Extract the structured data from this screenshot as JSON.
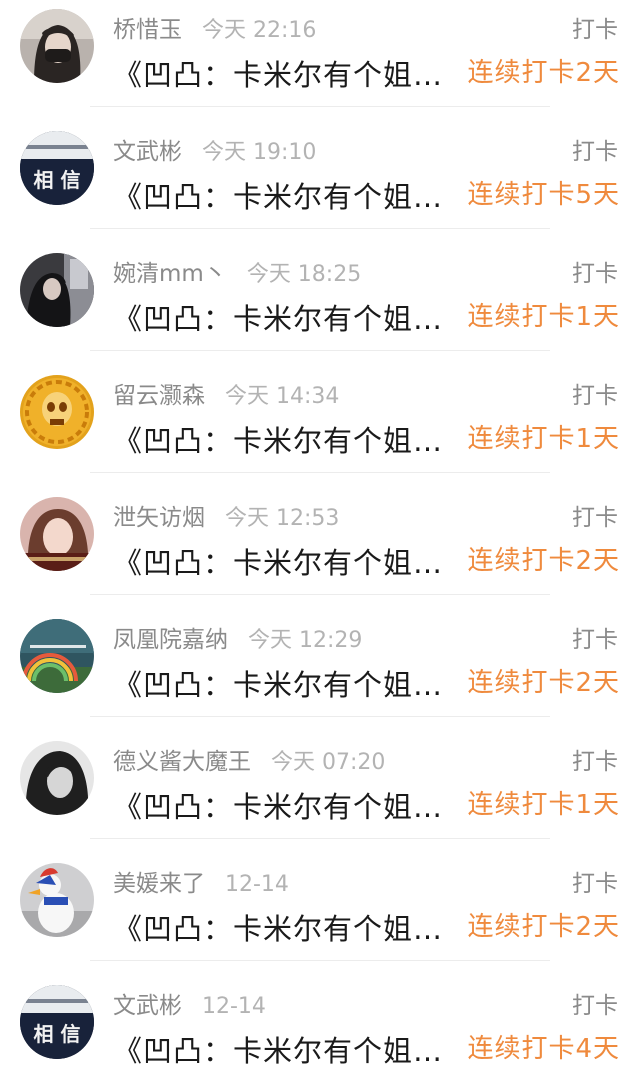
{
  "feed": {
    "items": [
      {
        "name": "桥惜玉",
        "time": "今天 22:16",
        "action": "打卡",
        "title": "《凹凸：卡米尔有个姐…",
        "streak": "连续打卡2天",
        "avatar": "avatar-masked-girl"
      },
      {
        "name": "文武彬",
        "time": "今天 19:10",
        "action": "打卡",
        "title": "《凹凸：卡米尔有个姐…",
        "streak": "连续打卡5天",
        "avatar": "avatar-text-xiangxin"
      },
      {
        "name": "婉清mm丶",
        "time": "今天 18:25",
        "action": "打卡",
        "title": "《凹凸：卡米尔有个姐…",
        "streak": "连续打卡1天",
        "avatar": "avatar-dark-figure"
      },
      {
        "name": "留云灏森",
        "time": "今天 14:34",
        "action": "打卡",
        "title": "《凹凸：卡米尔有个姐…",
        "streak": "连续打卡1天",
        "avatar": "avatar-golden-skull"
      },
      {
        "name": "泄矢访烟",
        "time": "今天 12:53",
        "action": "打卡",
        "title": "《凹凸：卡米尔有个姐…",
        "streak": "连续打卡2天",
        "avatar": "avatar-portrait"
      },
      {
        "name": "凤凰院嘉纳",
        "time": "今天 12:29",
        "action": "打卡",
        "title": "《凹凸：卡米尔有个姐…",
        "streak": "连续打卡2天",
        "avatar": "avatar-rainbow-landscape"
      },
      {
        "name": "德义酱大魔王",
        "time": "今天 07:20",
        "action": "打卡",
        "title": "《凹凸：卡米尔有个姐…",
        "streak": "连续打卡1天",
        "avatar": "avatar-grayscale-girl"
      },
      {
        "name": "美媛来了",
        "time": "12-14",
        "action": "打卡",
        "title": "《凹凸：卡米尔有个姐…",
        "streak": "连续打卡2天",
        "avatar": "avatar-duck-toy"
      },
      {
        "name": "文武彬",
        "time": "12-14",
        "action": "打卡",
        "title": "《凹凸：卡米尔有个姐…",
        "streak": "连续打卡4天",
        "avatar": "avatar-text-xiangxin"
      }
    ]
  },
  "colors": {
    "name": "#8a8a8a",
    "time": "#b3b3b3",
    "title": "#1a1a1a",
    "streak": "#ef8a3d",
    "divider": "#ececec"
  }
}
